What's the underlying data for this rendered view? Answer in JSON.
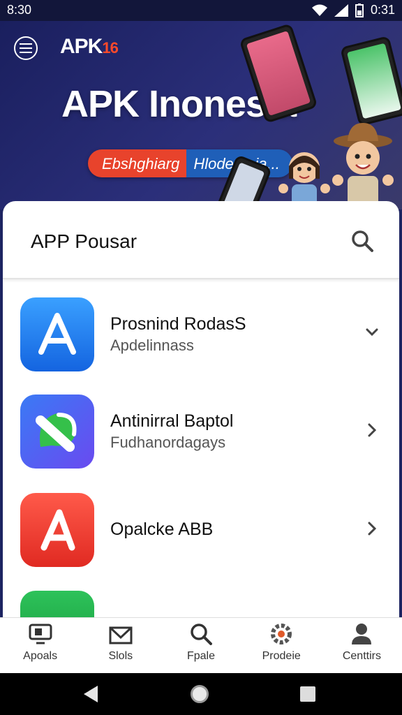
{
  "status_bar": {
    "time_left": "8:30",
    "time_right": "0:31"
  },
  "hero": {
    "logo_text": "APK",
    "logo_accent": "16",
    "title": "APK Inonesia",
    "pill_left": "Ebshghiarg",
    "pill_right": "Hlodemeia..."
  },
  "search": {
    "placeholder": "APP Pousar"
  },
  "apps": [
    {
      "title": "Prosnind RodasS",
      "subtitle": "Apdelinnass",
      "icon": "app-store-icon",
      "color": "#1f7ff0"
    },
    {
      "title": "Antinirral Baptol",
      "subtitle": "Fudhanordagays",
      "icon": "chat-pen-icon",
      "color": "#2e6cf0"
    },
    {
      "title": "Opalcke ABB",
      "subtitle": "",
      "icon": "app-a-icon",
      "color": "#f03a2e"
    },
    {
      "title": "",
      "subtitle": "",
      "icon": "green-app-icon",
      "color": "#22b04a"
    }
  ],
  "nav": [
    {
      "label": "Apoals",
      "icon": "monitor-icon"
    },
    {
      "label": "Slols",
      "icon": "envelope-icon"
    },
    {
      "label": "Fpale",
      "icon": "search-icon"
    },
    {
      "label": "Prodeie",
      "icon": "gear-icon"
    },
    {
      "label": "Centtirs",
      "icon": "person-icon"
    }
  ]
}
